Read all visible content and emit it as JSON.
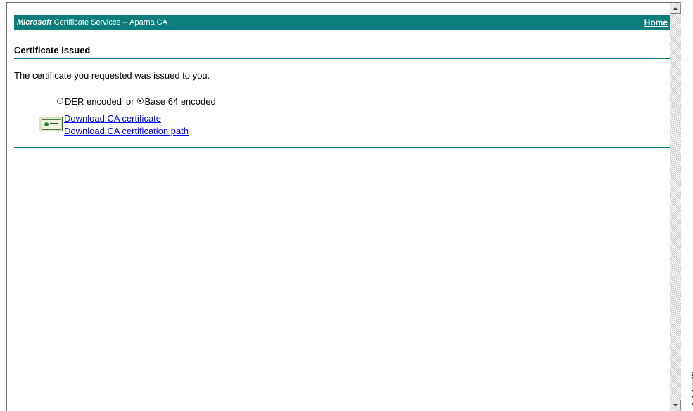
{
  "banner": {
    "brand_bold": "Microsoft",
    "brand_rest": "Certificate Services  --  Aparna CA",
    "home_link": "Home",
    "color": "#0b7d7d"
  },
  "page": {
    "title": "Certificate Issued",
    "message": "The certificate you requested was issued to you."
  },
  "encoding": {
    "option_der": "DER encoded",
    "separator": "or",
    "option_base64": "Base 64 encoded",
    "selected": "Base 64 encoded"
  },
  "links": {
    "download_ca_certificate": "Download CA certificate",
    "download_ca_certification_path": "Download CA certification path"
  },
  "icons": {
    "certificate": "certificate-icon"
  },
  "figure_id": "144773"
}
